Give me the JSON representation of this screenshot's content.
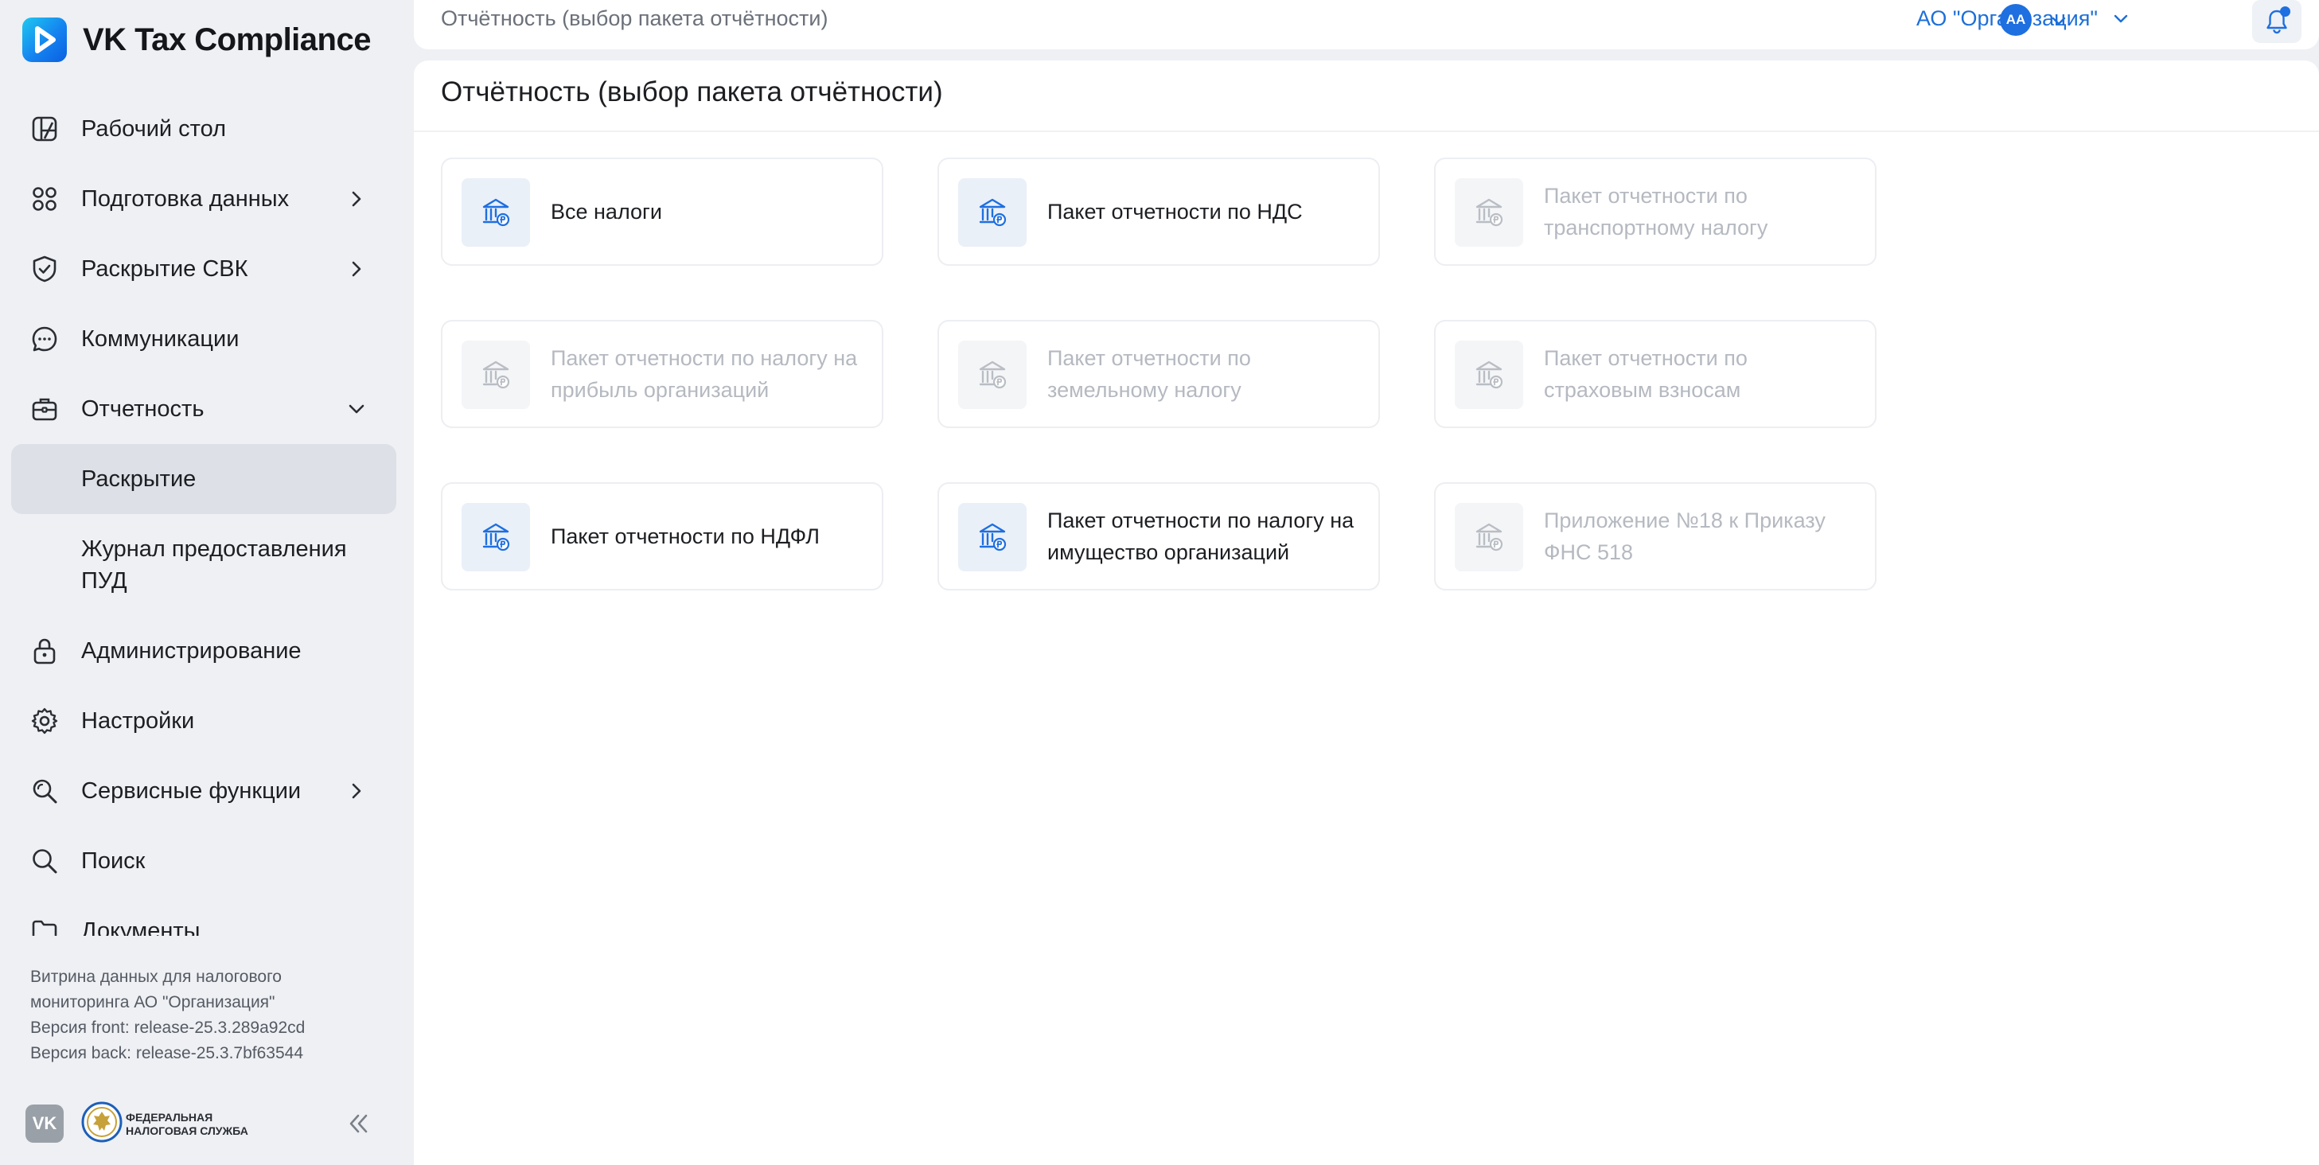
{
  "app": {
    "name": "VK Tax Compliance"
  },
  "sidebar": {
    "items": [
      {
        "label": "Рабочий стол",
        "icon": "dashboard-icon",
        "chevron": ""
      },
      {
        "label": "Подготовка данных",
        "icon": "data-prep-icon",
        "chevron": "right"
      },
      {
        "label": "Раскрытие СВК",
        "icon": "shield-icon",
        "chevron": "right"
      },
      {
        "label": "Коммуникации",
        "icon": "chat-icon",
        "chevron": ""
      },
      {
        "label": "Отчетность",
        "icon": "briefcase-icon",
        "chevron": "down"
      }
    ],
    "subitems": [
      {
        "label": "Раскрытие",
        "active": true
      },
      {
        "label": "Журнал предоставления ПУД",
        "active": false
      }
    ],
    "items_after": [
      {
        "label": "Администрирование",
        "icon": "lock-icon",
        "chevron": ""
      },
      {
        "label": "Настройки",
        "icon": "gear-icon",
        "chevron": ""
      },
      {
        "label": "Сервисные функции",
        "icon": "service-search-icon",
        "chevron": "right"
      },
      {
        "label": "Поиск",
        "icon": "search-icon",
        "chevron": ""
      },
      {
        "label": "Документы",
        "icon": "folder-icon",
        "chevron": ""
      }
    ],
    "footer": {
      "line1": "Витрина данных для налогового",
      "line2": "мониторинга АО \"Организация\"",
      "line3": "Версия front: release-25.3.289a92cd",
      "line4": "Версия back: release-25.3.7bf63544"
    },
    "logos": {
      "vk": "VK",
      "fns_line1": "Федеральная",
      "fns_line2": "налоговая служба"
    }
  },
  "topbar": {
    "breadcrumb": "Отчётность (выбор пакета отчётности)",
    "organization": "АО \"Организация\"",
    "avatar_initials": "АА"
  },
  "main": {
    "title": "Отчётность (выбор пакета отчётности)",
    "cards": [
      {
        "label": "Все налоги",
        "enabled": true
      },
      {
        "label": "Пакет отчетности по НДС",
        "enabled": true
      },
      {
        "label": "Пакет отчетности по транспортному налогу",
        "enabled": false
      },
      {
        "label": "Пакет отчетности по налогу на прибыль организаций",
        "enabled": false
      },
      {
        "label": "Пакет отчетности по земельному налогу",
        "enabled": false
      },
      {
        "label": "Пакет отчетности по страховым взносам",
        "enabled": false
      },
      {
        "label": "Пакет отчетности по НДФЛ",
        "enabled": true
      },
      {
        "label": "Пакет отчетности по налогу на имущество организаций",
        "enabled": true
      },
      {
        "label": "Приложение №18 к Приказу ФНС 518",
        "enabled": false
      }
    ]
  },
  "colors": {
    "accent": "#1e6fe0",
    "icon_enabled": "#1e6fe0",
    "icon_disabled": "#b9bdc4",
    "active_nav_bg": "#dde0e6"
  }
}
